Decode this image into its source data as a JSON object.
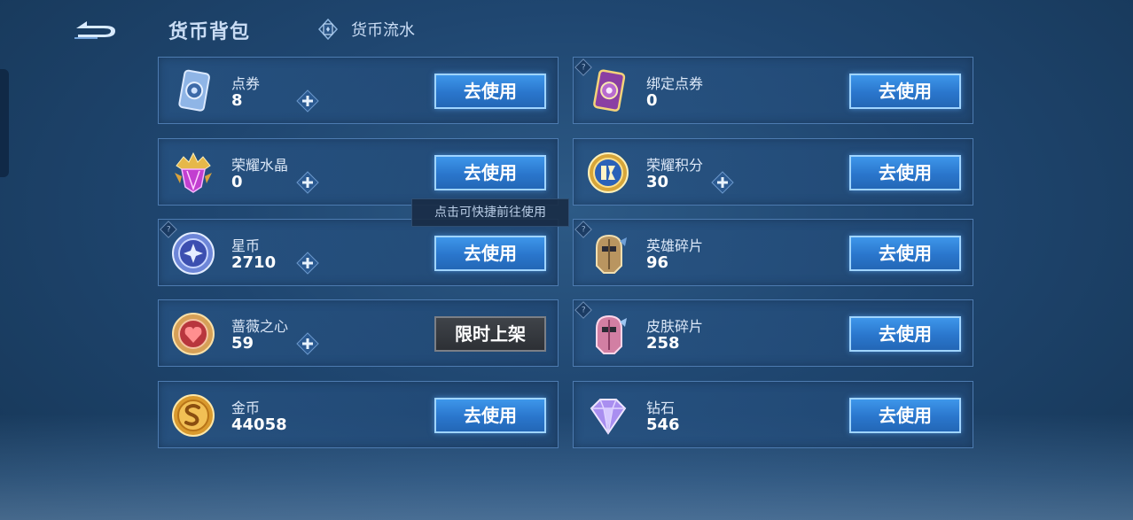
{
  "header": {
    "title": "货币背包",
    "flow_label": "货币流水"
  },
  "tooltip": "点击可快捷前往使用",
  "currencies": [
    {
      "name": "点券",
      "value": "8",
      "button": "去使用"
    },
    {
      "name": "绑定点券",
      "value": "0",
      "button": "去使用"
    },
    {
      "name": "荣耀水晶",
      "value": "0",
      "button": "去使用"
    },
    {
      "name": "荣耀积分",
      "value": "30",
      "button": "去使用"
    },
    {
      "name": "星币",
      "value": "2710",
      "button": "去使用"
    },
    {
      "name": "英雄碎片",
      "value": "96",
      "button": "去使用"
    },
    {
      "name": "蔷薇之心",
      "value": "59",
      "button": "限时上架"
    },
    {
      "name": "皮肤碎片",
      "value": "258",
      "button": "去使用"
    },
    {
      "name": "金币",
      "value": "44058",
      "button": "去使用"
    },
    {
      "name": "钻石",
      "value": "546",
      "button": "去使用"
    }
  ],
  "colors": {
    "accent_button": "#2a76cc",
    "card_border": "#4d7bb0",
    "background": "#1f4670"
  }
}
